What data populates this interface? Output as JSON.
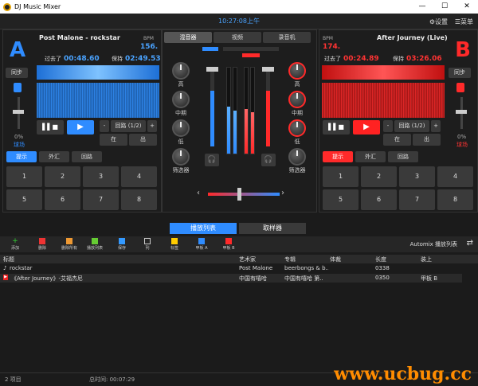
{
  "window": {
    "title": "DJ Music Mixer",
    "minimize": "—",
    "maximize": "☐",
    "close": "✕"
  },
  "topbar": {
    "clock": "10:27:08上午",
    "settings": "⚙设置",
    "menu": "☰菜单"
  },
  "deckA": {
    "letter": "A",
    "track": "Post Malone - rockstar",
    "bpm_label": "BPM",
    "bpm": "156.",
    "elapsed_label": "过去了",
    "elapsed": "00:48.60",
    "remain_label": "保持",
    "remain": "02:49.53",
    "sync": "同步",
    "pitch_pct": "0%",
    "pitch_label": "球场",
    "loop": "回路 (1/2)",
    "minus": "-",
    "plus": "+",
    "in": "在",
    "out": "出",
    "pad_tabs": [
      "提示",
      "外汇",
      "回路"
    ],
    "pads": [
      "1",
      "2",
      "3",
      "4",
      "5",
      "6",
      "7",
      "8"
    ]
  },
  "deckB": {
    "letter": "B",
    "track": "After Journey (Live)",
    "bpm_label": "BPM",
    "bpm": "174.",
    "elapsed_label": "过去了",
    "elapsed": "00:24.89",
    "remain_label": "保持",
    "remain": "03:26.06",
    "sync": "同步",
    "pitch_pct": "0%",
    "pitch_label": "球场",
    "loop": "回路 (1/2)",
    "minus": "-",
    "plus": "+",
    "in": "在",
    "out": "出",
    "pad_tabs": [
      "提示",
      "外汇",
      "回路"
    ],
    "pads": [
      "1",
      "2",
      "3",
      "4",
      "5",
      "6",
      "7",
      "8"
    ]
  },
  "mixer": {
    "tabs": [
      "混音器",
      "视频",
      "录音机"
    ],
    "knob_labels": [
      "高",
      "中期",
      "低",
      "筛选器"
    ],
    "colors": {
      "deckA": "#2f8cff",
      "deckB": "#ff2a2a"
    }
  },
  "bottom": {
    "tabs": [
      "播放列表",
      "取样器"
    ],
    "tools": [
      "添加",
      "删除",
      "删除所有",
      "播放列表",
      "保存",
      "列",
      "标签",
      "甲板 A",
      "甲板 B"
    ],
    "automix": "Automix 播放列表",
    "columns": [
      "标题",
      "艺术家",
      "专辑",
      "体裁",
      "长度",
      "装上"
    ],
    "rows": [
      {
        "title": "rockstar",
        "artist": "Post Malone",
        "album": "beerbongs & b..",
        "genre": "",
        "length": "0338",
        "deck": ""
      },
      {
        "title": "《After Journey》-艾福杰尼",
        "artist": "中国有嘻哈",
        "album": "中国有嘻哈 第..",
        "genre": "",
        "length": "0350",
        "deck": "甲板 B"
      }
    ]
  },
  "status": {
    "items": "2 项目",
    "total": "总时间: 00:07:29",
    "watermark": "www.ucbug.cc"
  }
}
